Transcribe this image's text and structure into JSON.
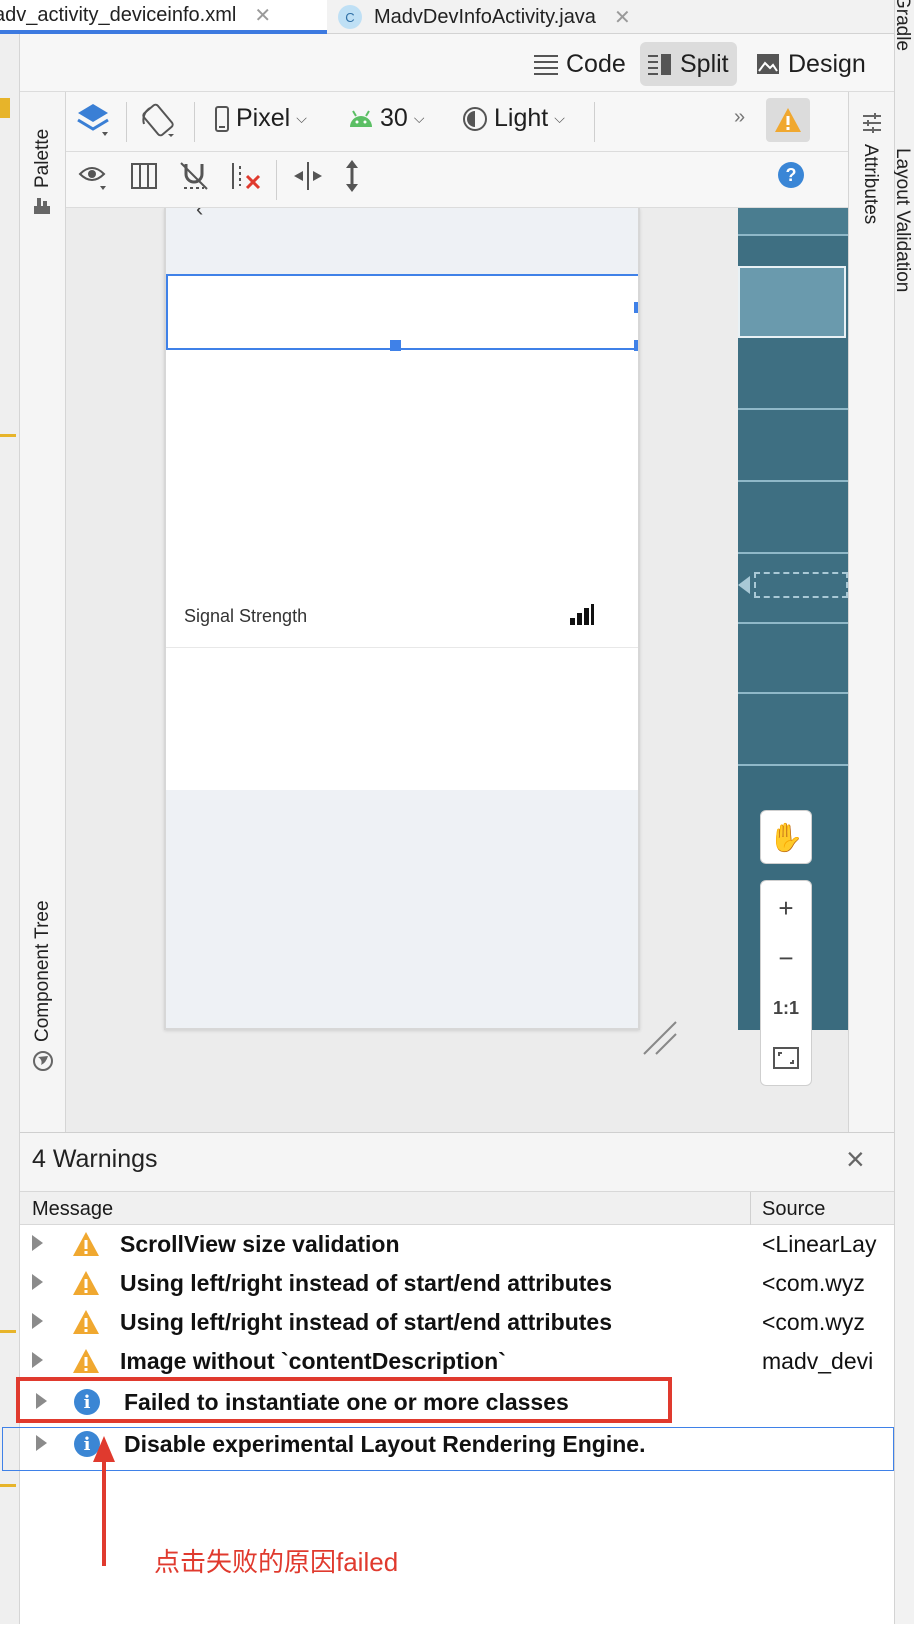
{
  "tabs": [
    {
      "label": "adv_activity_deviceinfo.xml",
      "active": true
    },
    {
      "label": "MadvDevInfoActivity.java",
      "badge": "C"
    }
  ],
  "view_modes": {
    "code": "Code",
    "split": "Split",
    "design": "Design",
    "selected": "Split"
  },
  "side_panels": {
    "palette": "Palette",
    "component_tree": "Component Tree",
    "attributes": "Attributes",
    "gradle": "Gradle",
    "layout_validation": "Layout Validation"
  },
  "design_toolbar": {
    "device": "Pixel",
    "api_level": "30",
    "theme": "Light",
    "overflow": "»"
  },
  "preview": {
    "signal_label": "Signal Strength"
  },
  "zoom": {
    "one_to_one": "1:1",
    "plus": "+",
    "minus": "−"
  },
  "warnings": {
    "title": "4 Warnings",
    "columns": {
      "message": "Message",
      "source": "Source"
    },
    "rows": [
      {
        "type": "warning",
        "message": "ScrollView size validation",
        "source": "<LinearLay"
      },
      {
        "type": "warning",
        "message": "Using left/right instead of start/end attributes",
        "source": "<com.wyz"
      },
      {
        "type": "warning",
        "message": "Using left/right instead of start/end attributes",
        "source": "<com.wyz"
      },
      {
        "type": "warning",
        "message": "Image without `contentDescription`",
        "source": "madv_devi"
      },
      {
        "type": "info",
        "message": "Failed to instantiate one or more classes",
        "source": ""
      },
      {
        "type": "info",
        "message": "Disable experimental Layout Rendering Engine.",
        "source": ""
      }
    ]
  },
  "annotation": {
    "text": "点击失败的原因failed",
    "color": "#e03a2e"
  },
  "colors": {
    "accent": "#3f81e8",
    "warning": "#f0a830",
    "info": "#3b86d4",
    "blueprint": "#3e6f82"
  }
}
